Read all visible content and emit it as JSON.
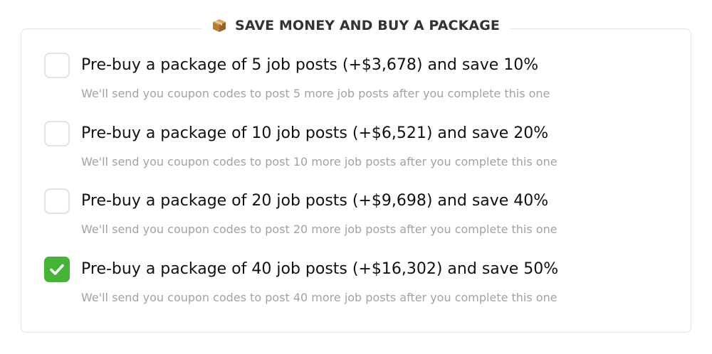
{
  "header": {
    "icon": "package-box-icon",
    "title": "SAVE MONEY AND BUY A PACKAGE"
  },
  "colors": {
    "checked": "#45b336",
    "border": "#e2e2e2",
    "title_text": "#111111",
    "desc_text": "#a2a2a2"
  },
  "options": [
    {
      "label": "Pre-buy a package of 5 job posts (+$3,678) and save 10%",
      "description": "We'll send you coupon codes to post 5 more job posts after you complete this one",
      "checked": false
    },
    {
      "label": "Pre-buy a package of 10 job posts (+$6,521) and save 20%",
      "description": "We'll send you coupon codes to post 10 more job posts after you complete this one",
      "checked": false
    },
    {
      "label": "Pre-buy a package of 20 job posts (+$9,698) and save 40%",
      "description": "We'll send you coupon codes to post 20 more job posts after you complete this one",
      "checked": false
    },
    {
      "label": "Pre-buy a package of 40 job posts (+$16,302) and save 50%",
      "description": "We'll send you coupon codes to post 40 more job posts after you complete this one",
      "checked": true
    }
  ]
}
